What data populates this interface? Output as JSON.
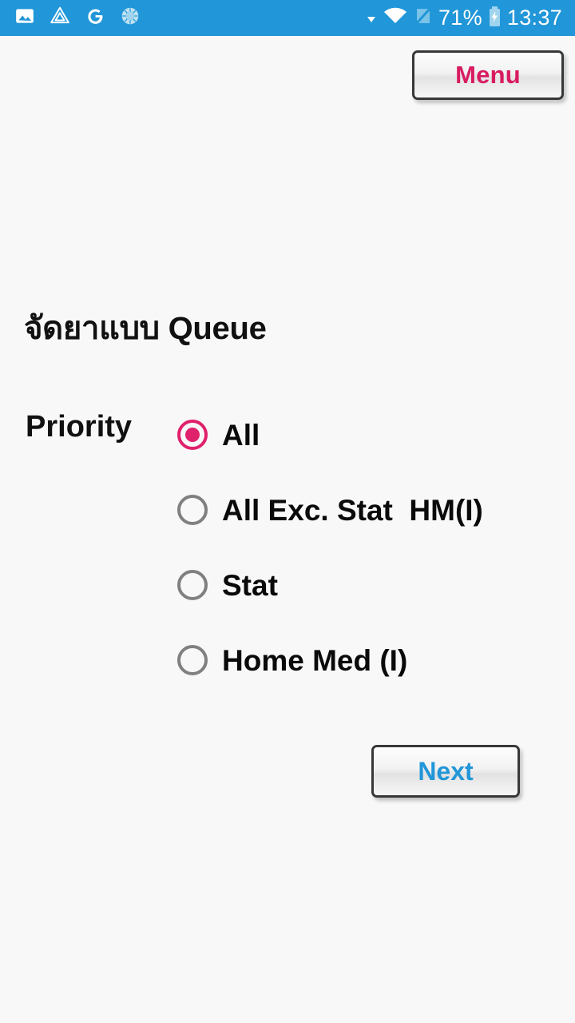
{
  "status_bar": {
    "background_color": "#2196d8",
    "left_icons": [
      {
        "name": "photo-icon",
        "label": "image"
      },
      {
        "name": "affinity-app-icon",
        "label": "app"
      },
      {
        "name": "google-icon",
        "label": "G"
      },
      {
        "name": "sunburst-sync-icon",
        "label": "sync"
      }
    ],
    "dropdown_caret": "▾",
    "wifi_icon": "wifi",
    "no_sim_icon": "no-sim",
    "battery_percent": "71%",
    "battery_icon": "battery-charging",
    "time": "13:37"
  },
  "toolbar": {
    "menu_label": "Menu",
    "menu_text_color": "#d81b60"
  },
  "main": {
    "title": "จัดยาแบบ Queue",
    "priority_label": "Priority",
    "options": [
      {
        "label": "All",
        "selected": true
      },
      {
        "label": "All Exc. Stat  HM(I)",
        "selected": false
      },
      {
        "label": "Stat",
        "selected": false
      },
      {
        "label": "Home Med (I)",
        "selected": false
      }
    ],
    "selected_color": "#e0216b",
    "unselected_color": "#808080"
  },
  "footer": {
    "next_label": "Next",
    "next_text_color": "#2196d8"
  }
}
